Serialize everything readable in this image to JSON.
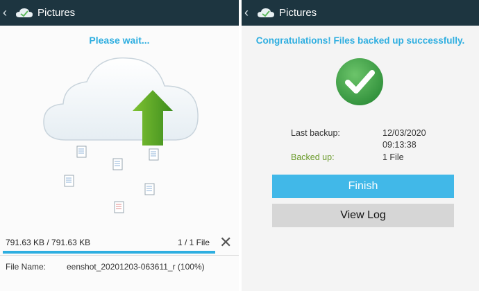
{
  "left": {
    "title": "Pictures",
    "heading": "Please wait...",
    "transfer_size": "791.63 KB / 791.63 KB",
    "file_count": "1 / 1 File",
    "progress_fraction": 1.0,
    "file_name_label": "File Name:",
    "file_name_value": "eenshot_20201203-063611_r (100%)"
  },
  "right": {
    "title": "Pictures",
    "heading": "Congratulations! Files backed up successfully.",
    "last_backup_label": "Last backup:",
    "last_backup_date": "12/03/2020",
    "last_backup_time": "09:13:38",
    "backed_up_label": "Backed up:",
    "backed_up_value": "1 File",
    "finish_label": "Finish",
    "view_log_label": "View Log"
  },
  "colors": {
    "titlebar": "#1d3540",
    "accent": "#2eaee0",
    "finish_button": "#41b8e8",
    "success_green": "#3fa64a"
  }
}
